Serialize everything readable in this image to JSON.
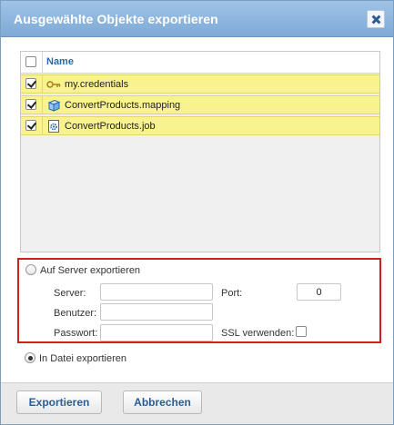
{
  "dialog": {
    "title": "Ausgewählte Objekte exportieren",
    "close_icon": "close-x-icon",
    "accent_color": "#8db6df"
  },
  "table": {
    "header": {
      "name_label": "Name",
      "select_all_checked": false
    },
    "rows": [
      {
        "label": "my.credentials",
        "icon": "key-icon",
        "checked": true
      },
      {
        "label": "ConvertProducts.mapping",
        "icon": "cube-icon",
        "checked": true
      },
      {
        "label": "ConvertProducts.job",
        "icon": "gear-document-icon",
        "checked": true
      }
    ],
    "row_highlight_color": "#f9f38f"
  },
  "server_export": {
    "radio_label": "Auf Server exportieren",
    "selected": false,
    "highlight_color": "#d11f1f",
    "server_label": "Server:",
    "server_value": "",
    "port_label": "Port:",
    "port_value": "0",
    "user_label": "Benutzer:",
    "user_value": "",
    "password_label": "Passwort:",
    "password_value": "",
    "ssl_label": "SSL verwenden:",
    "ssl_checked": false
  },
  "file_export": {
    "radio_label": "In Datei exportieren",
    "selected": true
  },
  "footer": {
    "export_label": "Exportieren",
    "cancel_label": "Abbrechen"
  }
}
